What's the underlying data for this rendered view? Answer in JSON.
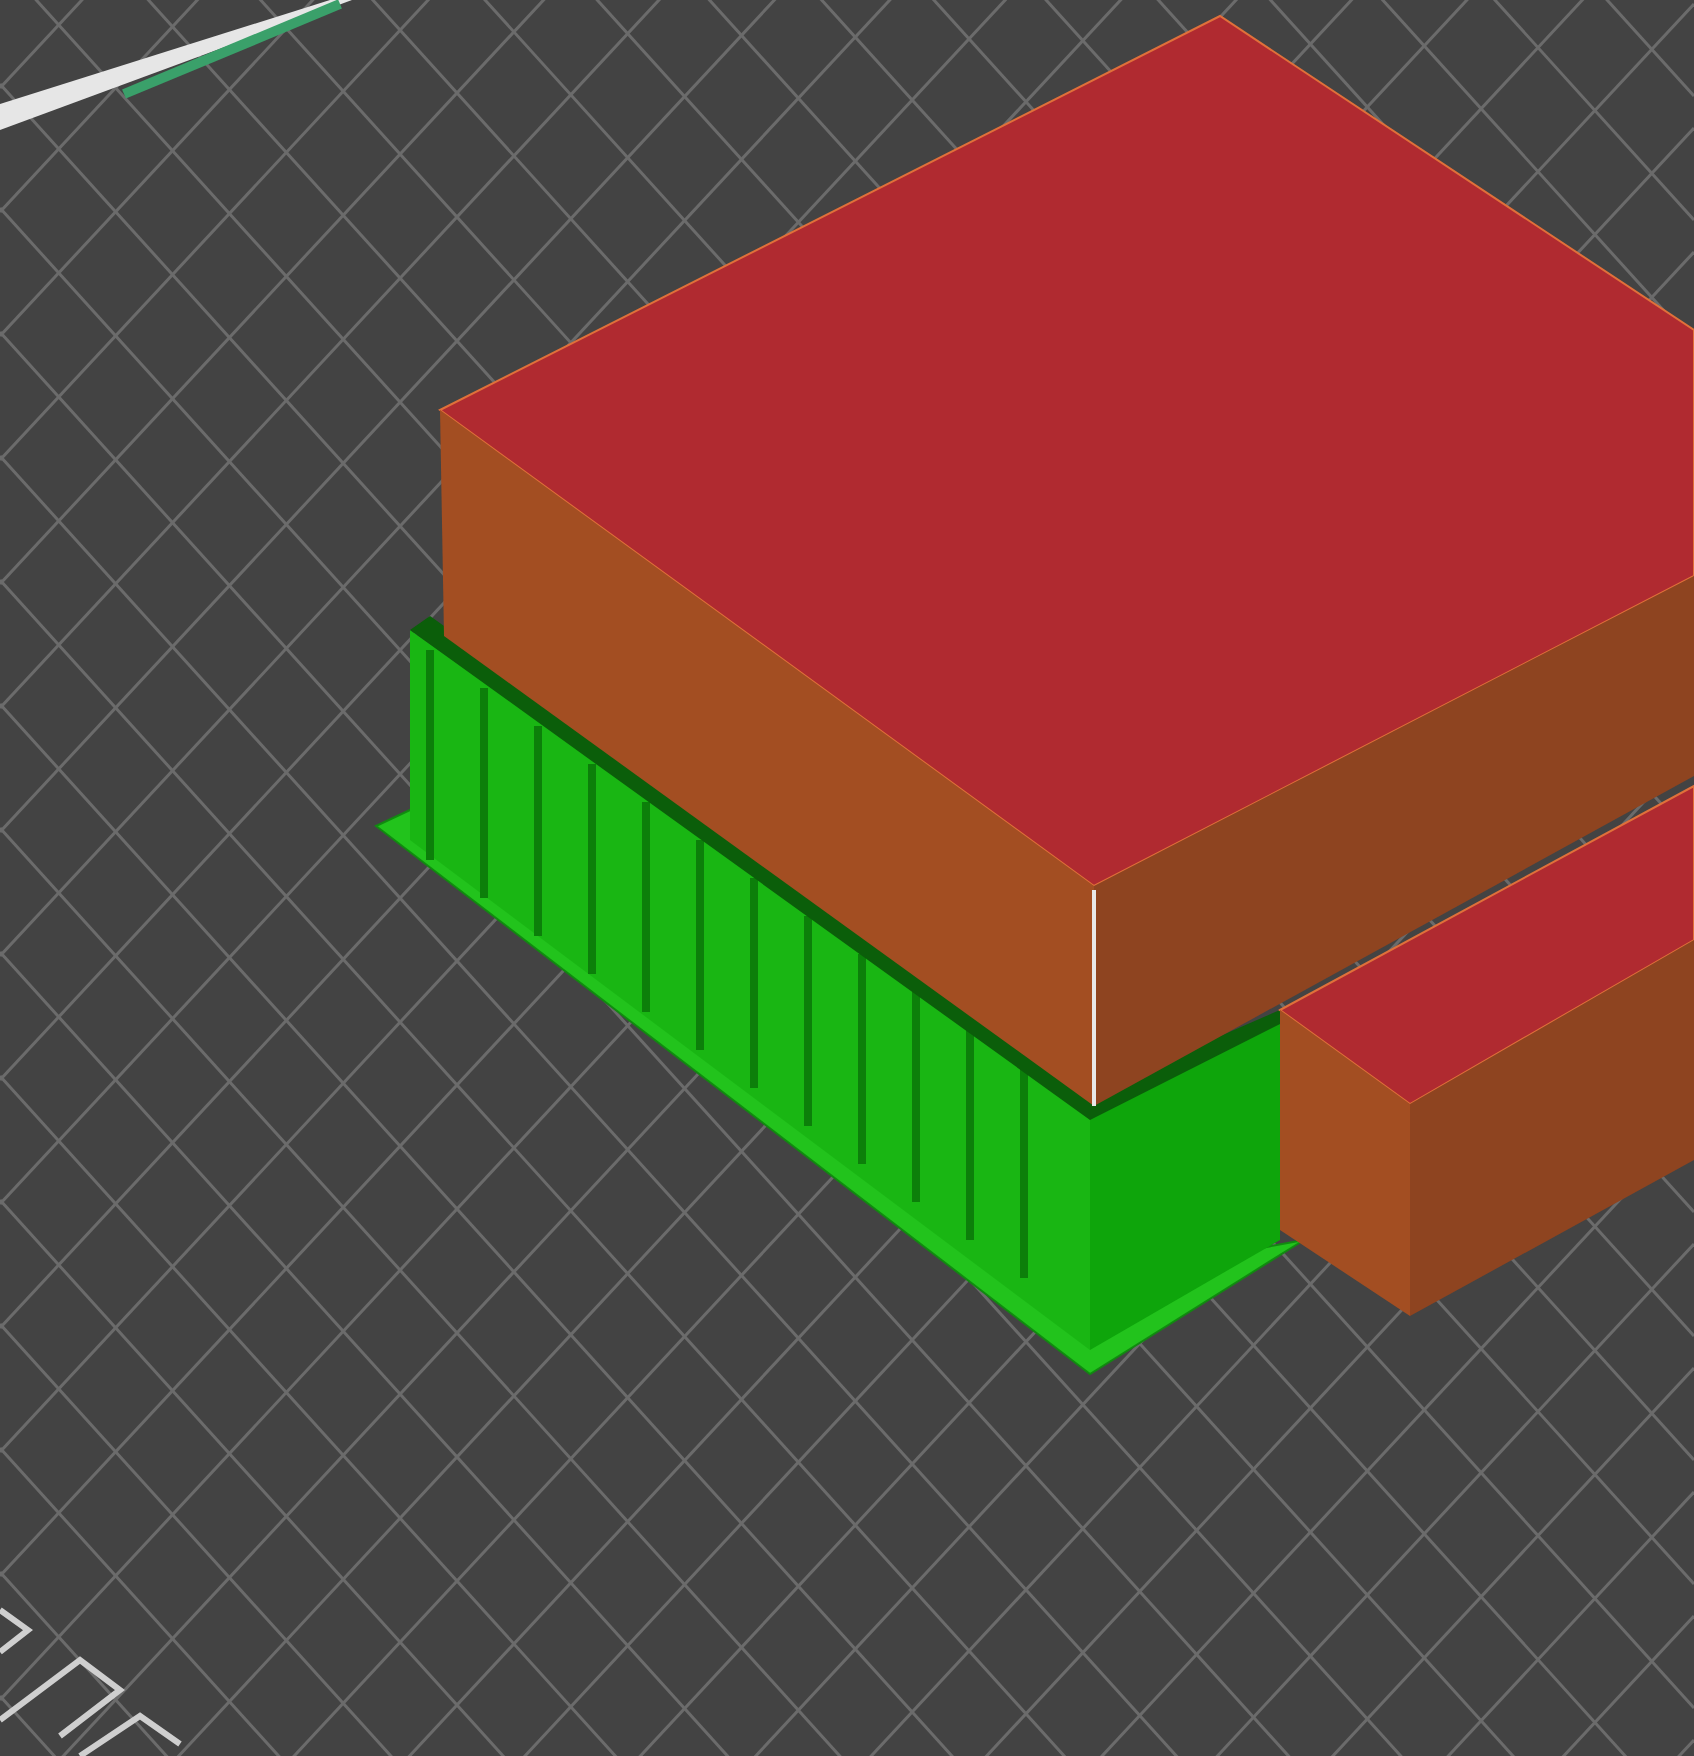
{
  "viewport": {
    "objects": [
      {
        "kind": "support"
      },
      {
        "kind": "model"
      },
      {
        "kind": "model"
      }
    ]
  }
}
